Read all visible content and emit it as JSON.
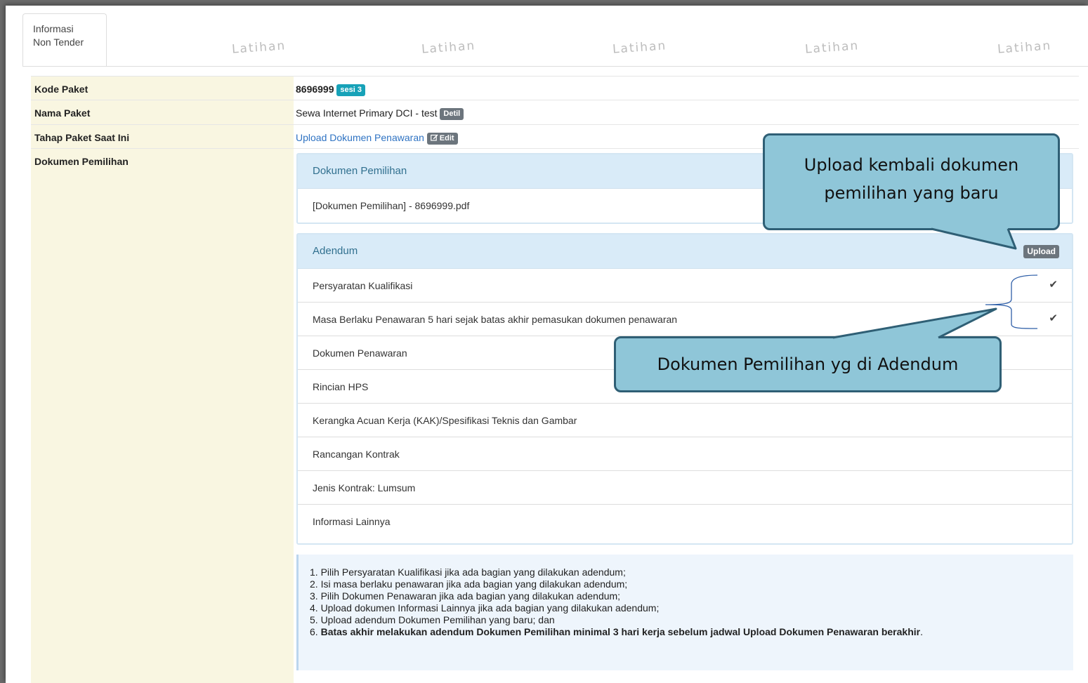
{
  "tab": {
    "line1": "Informasi",
    "line2": "Non Tender"
  },
  "watermark": "Latihan",
  "fields": {
    "kode_label": "Kode Paket",
    "kode_value": "8696999",
    "sesi_badge": "sesi 3",
    "nama_label": "Nama Paket",
    "nama_value": "Sewa Internet Primary DCI - test",
    "detil_badge": "Detil",
    "tahap_label": "Tahap Paket Saat Ini",
    "tahap_value": "Upload Dokumen Penawaran",
    "edit_badge": "Edit",
    "dokumen_label": "Dokumen Pemilihan"
  },
  "dokumen_panel": {
    "title": "Dokumen Pemilihan",
    "file": "[Dokumen Pemilihan] - 8696999.pdf"
  },
  "adendum_panel": {
    "title": "Adendum",
    "upload_label": "Upload",
    "items": [
      {
        "label": "Persyaratan Kualifikasi",
        "checked": true
      },
      {
        "label": "Masa Berlaku Penawaran 5 hari sejak batas akhir pemasukan dokumen penawaran",
        "checked": true
      },
      {
        "label": "Dokumen Penawaran",
        "checked": false
      },
      {
        "label": "Rincian HPS",
        "checked": false
      },
      {
        "label": "Kerangka Acuan Kerja (KAK)/Spesifikasi Teknis dan Gambar",
        "checked": false
      },
      {
        "label": "Rancangan Kontrak",
        "checked": false
      },
      {
        "label": "Jenis Kontrak: Lumsum",
        "checked": false
      },
      {
        "label": "Informasi Lainnya",
        "checked": false
      }
    ]
  },
  "notes": [
    "1. Pilih Persyaratan Kualifikasi jika ada bagian yang dilakukan adendum;",
    "2. Isi masa berlaku penawaran jika ada bagian yang dilakukan adendum;",
    "3. Pilih Dokumen Penawaran jika ada bagian yang dilakukan adendum;",
    "4. Upload dokumen Informasi Lainnya jika ada bagian yang dilakukan adendum;",
    "5. Upload adendum Dokumen Pemilihan yang baru; dan"
  ],
  "note6_prefix": "6. ",
  "note6_bold": "Batas akhir melakukan adendum Dokumen Pemilihan minimal 3 hari kerja sebelum jadwal Upload Dokumen Penawaran berakhir",
  "note6_suffix": ".",
  "callouts": {
    "upload_line1": "Upload kembali dokumen",
    "upload_line2": "pemilihan yang baru",
    "adendum": "Dokumen Pemilihan yg di Adendum"
  },
  "colors": {
    "callout_fill": "#8fc6d8",
    "callout_border": "#2f5f75",
    "label_bg": "#f9f6e1",
    "panel_head": "#d9ebf8"
  },
  "icons": {
    "edit": "edit-icon",
    "check": "check-icon"
  }
}
